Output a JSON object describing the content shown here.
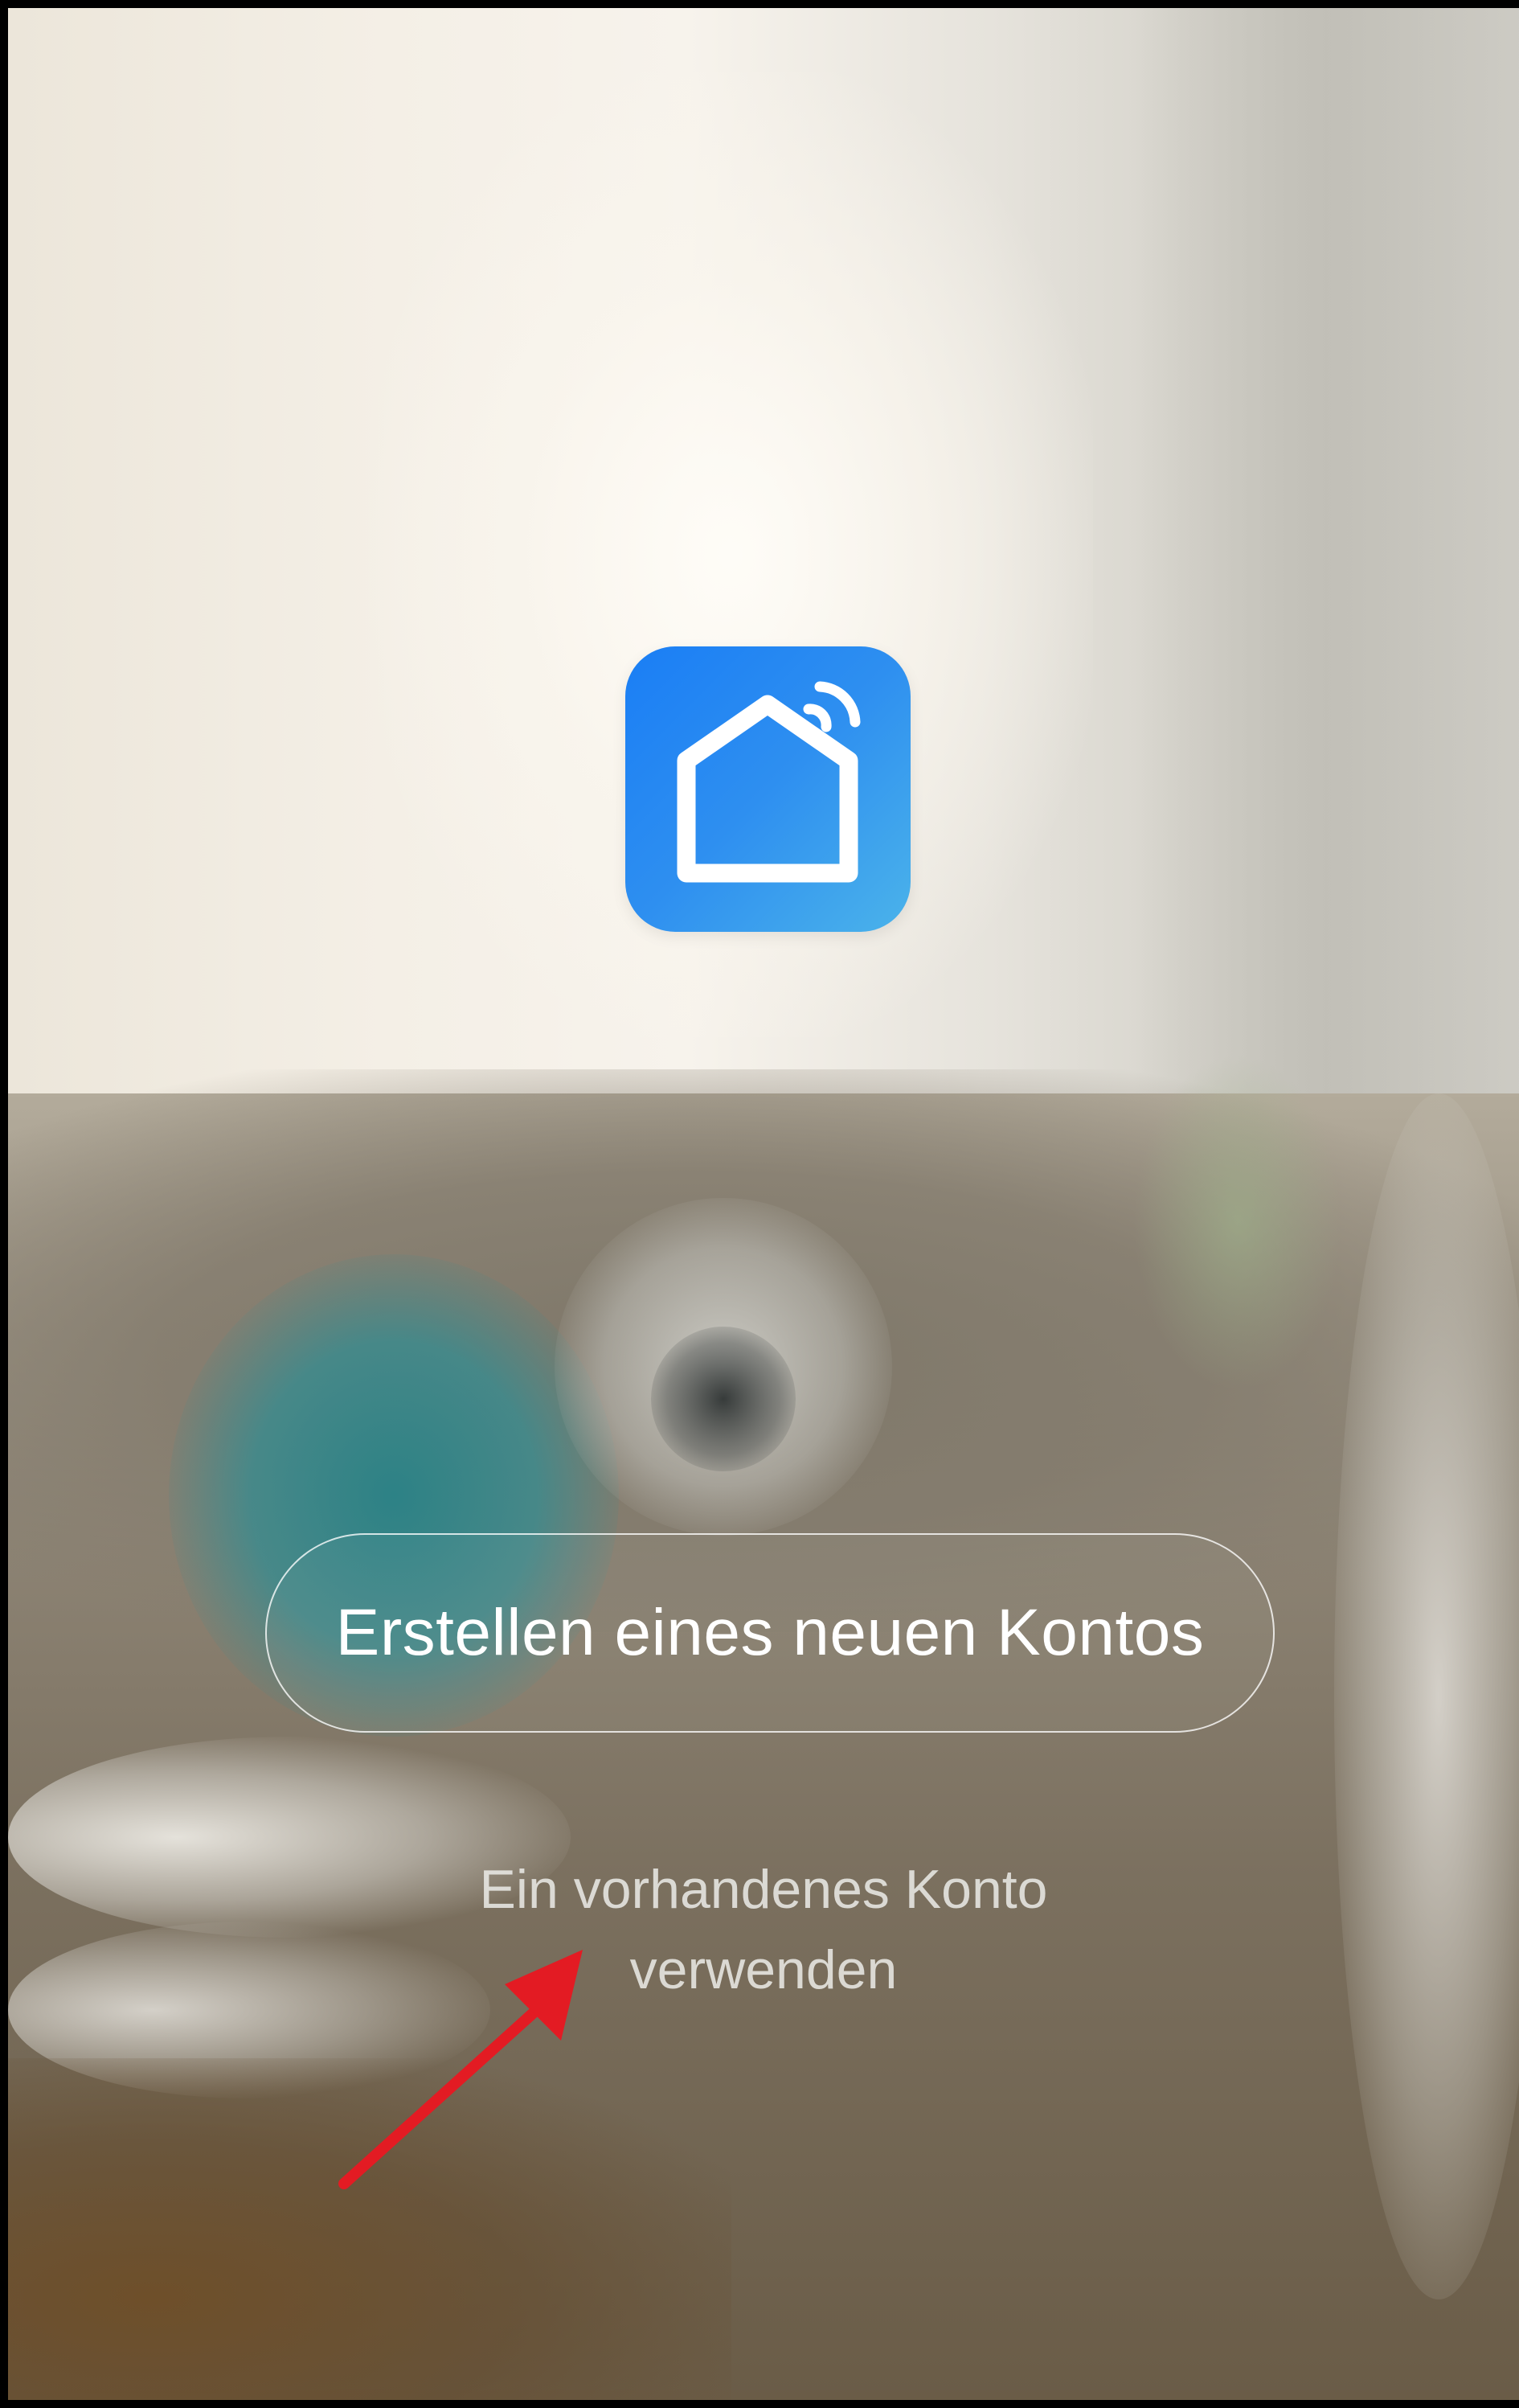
{
  "app": {
    "icon_name": "smart-home-wifi-icon",
    "icon_colors": {
      "gradient_start": "#1a7ef5",
      "gradient_end": "#4bb3ea",
      "glyph": "#ffffff"
    }
  },
  "actions": {
    "create_account_label": "Erstellen eines neuen Kontos",
    "existing_account_line1": "Ein vorhandenes Konto",
    "existing_account_line2": "verwenden"
  },
  "annotation": {
    "arrow_icon": "red-arrow",
    "arrow_color": "#e31b23"
  }
}
